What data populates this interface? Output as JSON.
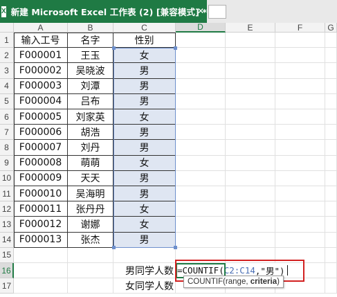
{
  "window": {
    "tab_title": "新建 Microsoft Excel 工作表 (2)  [兼容模式] *",
    "close_glyph": "✕",
    "app_icon_letter": "X"
  },
  "grid": {
    "columns": [
      "",
      "A",
      "B",
      "C",
      "D",
      "E",
      "F",
      "G"
    ],
    "rows": [
      "1",
      "2",
      "3",
      "4",
      "5",
      "6",
      "7",
      "8",
      "9",
      "10",
      "11",
      "12",
      "13",
      "14",
      "15",
      "16",
      "17"
    ],
    "active_column": "D",
    "active_row": "16"
  },
  "table": {
    "headers": [
      "输入工号",
      "名字",
      "性别"
    ],
    "rows": [
      [
        "F000001",
        "王玉",
        "女"
      ],
      [
        "F000002",
        "吴晓波",
        "男"
      ],
      [
        "F000003",
        "刘潭",
        "男"
      ],
      [
        "F000004",
        "吕布",
        "男"
      ],
      [
        "F000005",
        "刘家英",
        "女"
      ],
      [
        "F000006",
        "胡浩",
        "男"
      ],
      [
        "F000007",
        "刘丹",
        "男"
      ],
      [
        "F000008",
        "萌萌",
        "女"
      ],
      [
        "F000009",
        "天天",
        "男"
      ],
      [
        "F000010",
        "吴海明",
        "男"
      ],
      [
        "F000011",
        "张丹丹",
        "女"
      ],
      [
        "F000012",
        "谢娜",
        "女"
      ],
      [
        "F000013",
        "张杰",
        "男"
      ]
    ]
  },
  "labels": {
    "male_count": "男同学人数",
    "female_count": "女同学人数"
  },
  "formula": {
    "prefix": "=COUNTIF(",
    "range": "C2:C14",
    "suffix": ",\"男\")"
  },
  "tooltip": {
    "func": "COUNTIF(range, ",
    "arg_bold": "criteria",
    "close": ")"
  },
  "colors": {
    "excel_green": "#1f7a44",
    "selection_fill": "#dfe6f2",
    "selection_border": "#6d8fcc",
    "highlight_red": "#d22020"
  }
}
